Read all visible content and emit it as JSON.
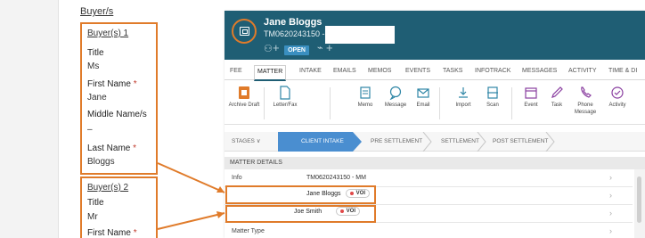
{
  "form": {
    "buyers_link": "Buyer/s",
    "buyer1": {
      "heading": "Buyer(s) 1",
      "title_label": "Title",
      "title_value": "Ms",
      "first_name_label": "First Name",
      "first_name_value": "Jane",
      "middle_name_label": "Middle Name/s",
      "middle_name_value": "–",
      "last_name_label": "Last Name",
      "last_name_value": "Bloggs",
      "required_marker": "*"
    },
    "buyer2": {
      "heading": "Buyer(s) 2",
      "title_label": "Title",
      "title_value": "Mr",
      "first_name_label": "First Name",
      "required_marker": "*"
    }
  },
  "app": {
    "client_name": "Jane Bloggs",
    "matter_number": "TM0620243150 -",
    "status": "OPEN",
    "tabs": [
      "FEE",
      "MATTER",
      "INTAKE",
      "EMAILS",
      "MEMOS",
      "EVENTS",
      "TASKS",
      "INFOTRACK",
      "MESSAGES",
      "ACTIVITY",
      "TIME & DI"
    ],
    "active_tab": "MATTER",
    "toolbar": [
      {
        "label": "Archive Draft",
        "icon": "archive-icon"
      },
      {
        "label": "Letter/Fax",
        "icon": "letter-icon"
      },
      {
        "label": "Memo",
        "icon": "memo-icon"
      },
      {
        "label": "Message",
        "icon": "message-icon"
      },
      {
        "label": "Email",
        "icon": "email-icon"
      },
      {
        "label": "Import",
        "icon": "import-icon"
      },
      {
        "label": "Scan",
        "icon": "scan-icon"
      },
      {
        "label": "Event",
        "icon": "event-icon"
      },
      {
        "label": "Task",
        "icon": "task-icon"
      },
      {
        "label": "Phone Message",
        "icon": "phone-icon"
      },
      {
        "label": "Activity",
        "icon": "activity-icon"
      }
    ],
    "stages": {
      "menu_label": "STAGES",
      "items": [
        "CLIENT INTAKE",
        "PRE SETTLEMENT",
        "SETTLEMENT",
        "POST SETTLEMENT"
      ],
      "active": "CLIENT INTAKE"
    },
    "section_title": "MATTER DETAILS",
    "details": {
      "info_label": "Info",
      "info_value": "TM0620243150 - MM",
      "contact1_name": "Jane Bloggs",
      "contact2_name": "Joe Smith",
      "badge_label": "VOI",
      "matter_type_label": "Matter Type"
    }
  },
  "colors": {
    "header_bg": "#1f5e74",
    "accent_orange": "#e07b2a",
    "stage_active": "#4a8ed0",
    "status_badge": "#3a8fc0",
    "voi_dot": "#e04848"
  }
}
